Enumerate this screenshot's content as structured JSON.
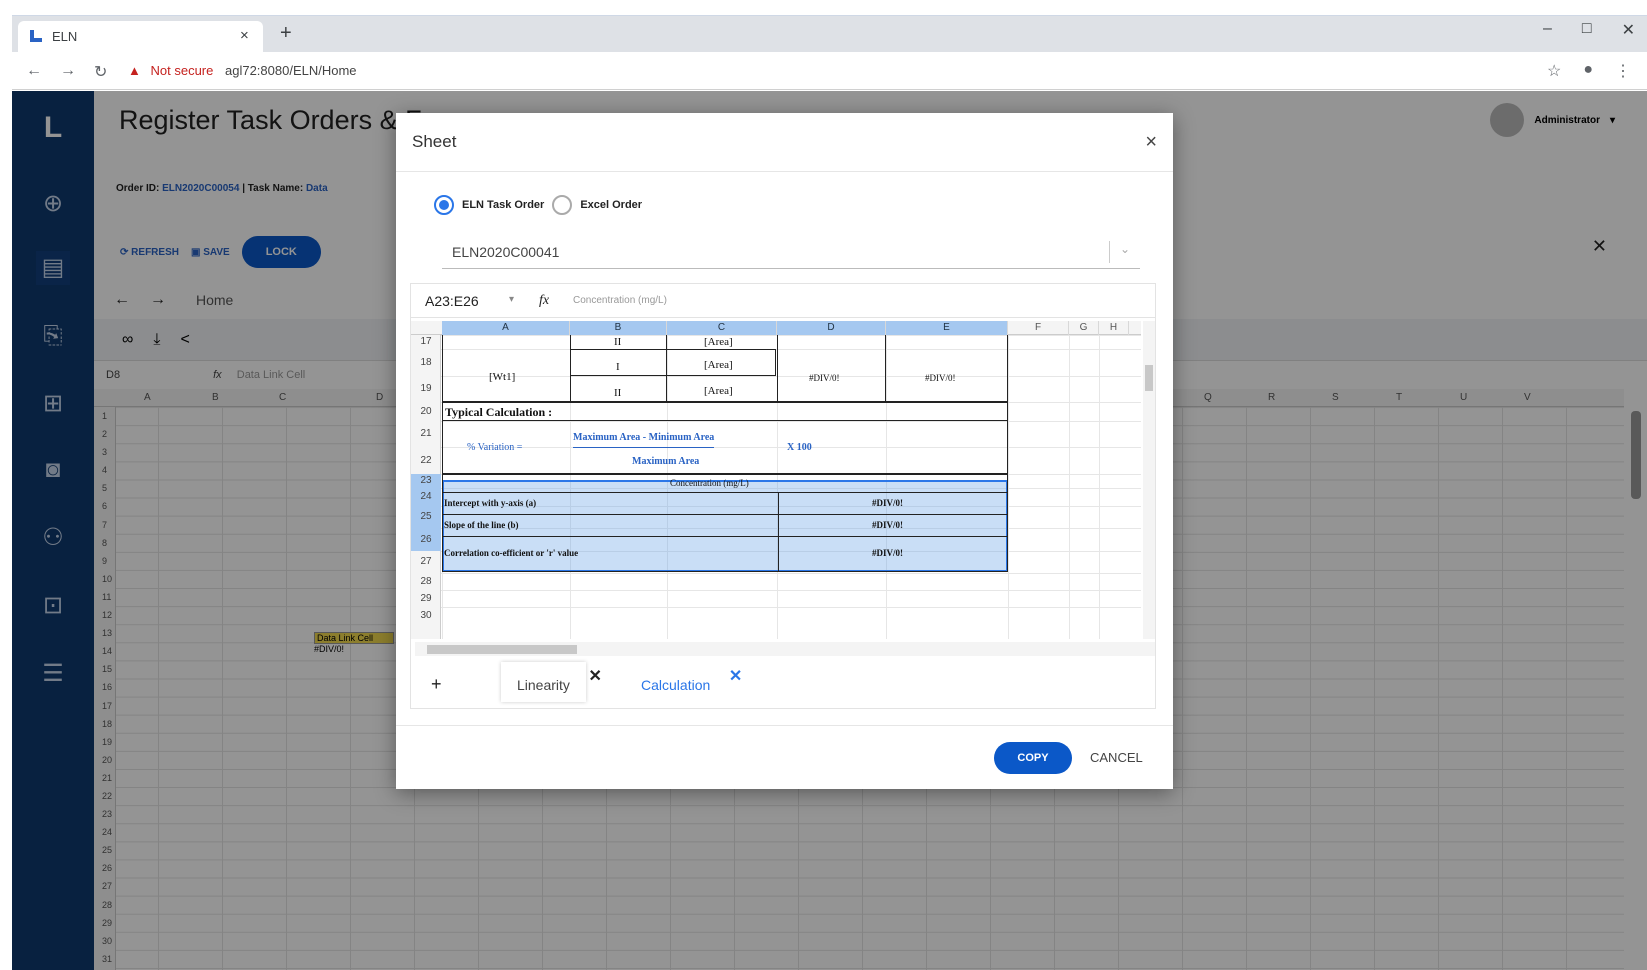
{
  "browser": {
    "tab_title": "ELN",
    "tab_close": "×",
    "new_tab": "+",
    "warning": "Not secure",
    "url": "agl72:8080/ELN/Home",
    "win_min": "–",
    "win_max": "□",
    "win_close": "✕"
  },
  "app": {
    "page_title": "Register Task Orders & F",
    "user": "Administrator",
    "order_id_label": "Order ID:",
    "order_id": "ELN2020C00054",
    "task_name_label": "| Task Name:",
    "task_name": "Data",
    "refresh_label": "REFRESH",
    "save_label": "SAVE",
    "lock_label": "LOCK",
    "home_label": "Home",
    "cell_ref": "D8",
    "formula_placeholder": "Data Link Cell",
    "bg_columns": [
      "A",
      "B",
      "C",
      "D",
      "Q",
      "R",
      "S",
      "T",
      "U",
      "V"
    ],
    "bg_rows": [
      "1",
      "2",
      "3",
      "4",
      "5",
      "6",
      "7",
      "8",
      "9",
      "10",
      "11",
      "12",
      "13",
      "14",
      "15",
      "16",
      "17",
      "18",
      "19",
      "20",
      "21",
      "22",
      "23",
      "24",
      "25",
      "26",
      "27",
      "28",
      "29",
      "30",
      "31"
    ],
    "bg_cell_d8": "Data Link Cell",
    "bg_cell_d9": "#DIV/0!"
  },
  "modal": {
    "title": "Sheet",
    "close": "×",
    "radio_eln": "ELN Task Order",
    "radio_excel": "Excel Order",
    "selected_order": "ELN2020C00041",
    "cell_ref": "A23:E26",
    "fx": "fx",
    "formula_value": "Concentration (mg/L)",
    "columns": [
      "A",
      "B",
      "C",
      "D",
      "E",
      "F",
      "G",
      "H"
    ],
    "rows": [
      "17",
      "18",
      "19",
      "20",
      "21",
      "22",
      "23",
      "24",
      "25",
      "26",
      "27",
      "28",
      "29",
      "30"
    ],
    "cells": {
      "r17_b": "II",
      "r17_c": "[Area]",
      "r18_a": "[Wt1]",
      "r18_b": "I",
      "r18_c": "[Area]",
      "r18_d": "#DIV/0!",
      "r18_e": "#DIV/0!",
      "r19_b": "II",
      "r19_c": "[Area]",
      "r20_a": "Typical Calculation :",
      "r21_a": "% Variation =",
      "r21_num": "Maximum Area - Minimum Area",
      "r21_mult": "X 100",
      "r22_den": "Maximum Area",
      "r23": "Concentration (mg/L)",
      "r24_a": "Intercept with y-axis (a)",
      "r24_d": "#DIV/0!",
      "r25_a": "Slope of the line (b)",
      "r25_d": "#DIV/0!",
      "r26_a": "Correlation co-efficient or 'r' value",
      "r26_d": "#DIV/0!"
    },
    "sheet_tabs": [
      {
        "label": "Linearity"
      },
      {
        "label": "Calculation"
      }
    ],
    "add_sheet": "+",
    "copy_label": "COPY",
    "cancel_label": "CANCEL"
  }
}
